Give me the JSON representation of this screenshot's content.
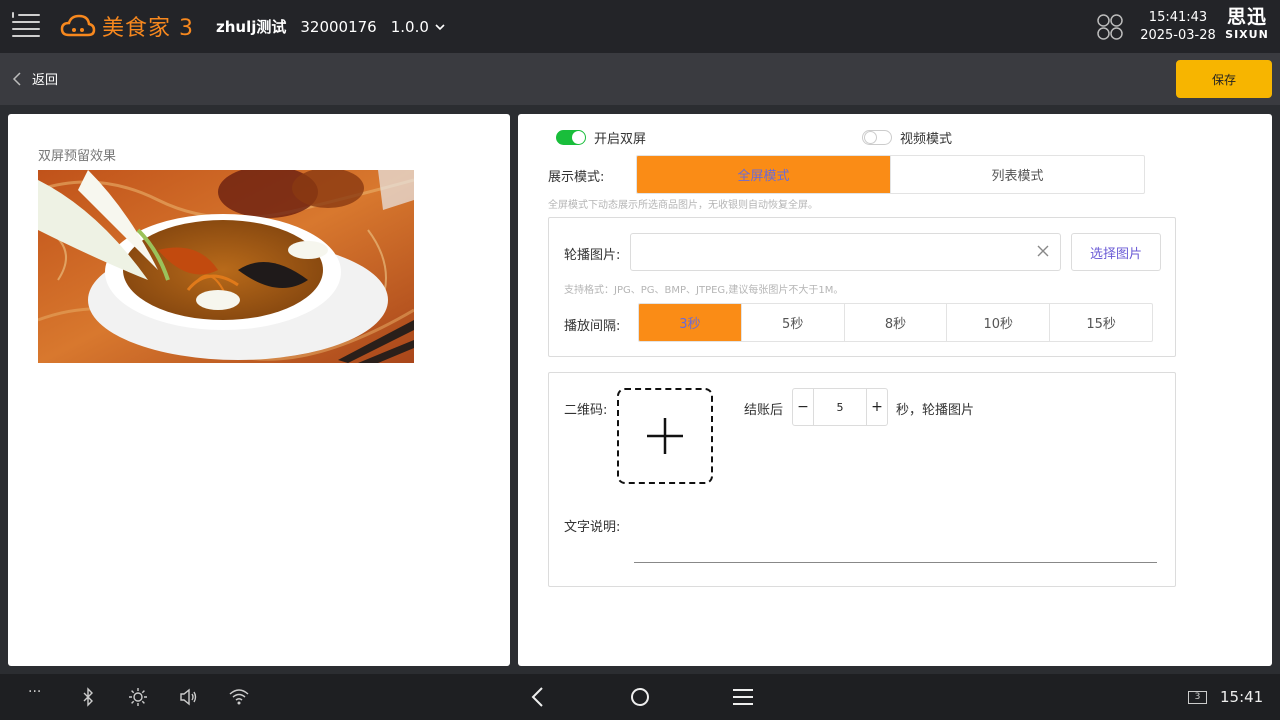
{
  "header": {
    "brand": "美食家 3",
    "store_name": "zhulj测试",
    "store_id": "32000176",
    "version": "1.0.0",
    "time": "15:41:43",
    "date": "2025-03-28",
    "logo_cn": "思迅",
    "logo_en": "SIXUN",
    "accent_color": "#f7881e"
  },
  "subbar": {
    "back_label": "返回",
    "save_label": "保存",
    "save_color": "#f7b500"
  },
  "preview": {
    "title": "双屏预留效果"
  },
  "settings": {
    "dual_screen": {
      "label": "开启双屏",
      "on": true
    },
    "video_mode": {
      "label": "视频模式",
      "on": false
    },
    "display_mode": {
      "label": "展示模式:",
      "options": [
        "全屏模式",
        "列表模式"
      ],
      "selected": "全屏模式"
    },
    "display_hint": "全屏模式下动态展示所选商品图片，无收银则自动恢复全屏。",
    "carousel": {
      "label": "轮播图片:",
      "value": "",
      "select_button": "选择图片",
      "format_hint": "支持格式：JPG、PG、BMP、JTPEG,建议每张图片不大于1M。"
    },
    "interval": {
      "label": "播放间隔:",
      "options": [
        "3秒",
        "5秒",
        "8秒",
        "10秒",
        "15秒"
      ],
      "selected": "3秒"
    },
    "qrcode": {
      "label": "二维码:",
      "after_checkout_prefix": "结账后",
      "seconds_value": "5",
      "after_checkout_suffix": "秒，轮播图片",
      "minus": "−",
      "plus": "+"
    },
    "text_desc": {
      "label": "文字说明:",
      "value": ""
    },
    "active_color": "#fa8c16",
    "toggle_on_color": "#19be3b"
  },
  "sysbar": {
    "time": "15:41",
    "screen_badge": "3",
    "more": "···"
  }
}
